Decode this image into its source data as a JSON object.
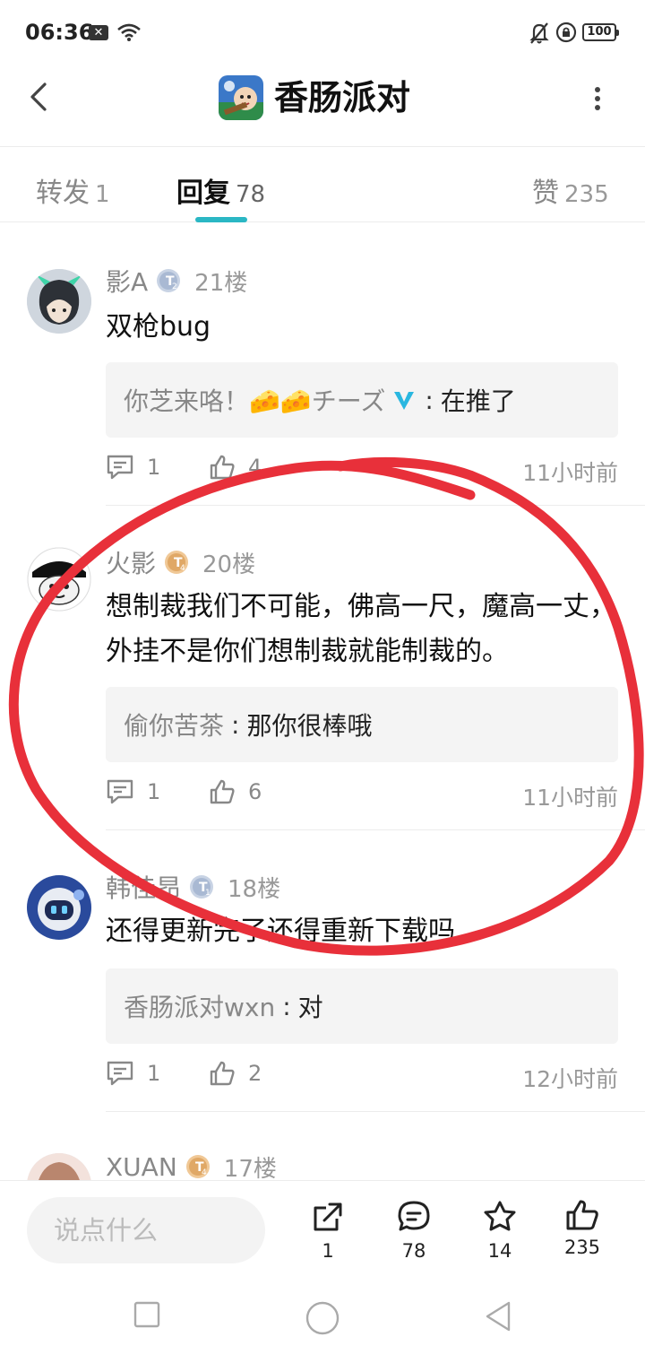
{
  "status_bar": {
    "time": "06:36",
    "battery": "100"
  },
  "header": {
    "title": "香肠派对"
  },
  "tabs": [
    {
      "label": "转发",
      "count": "1"
    },
    {
      "label": "回复",
      "count": "78"
    },
    {
      "label": "赞",
      "count": "235"
    }
  ],
  "colors": {
    "accent": "#2ab7c4",
    "annotation": "#e8303a"
  },
  "comments": [
    {
      "user": "影A",
      "floor": "21楼",
      "text": "双枪bug",
      "reply_user": "你芝来咯！🧀🧀チーズ",
      "reply_text": "在推了",
      "comment_count": "1",
      "like_count": "4",
      "time": "11小时前"
    },
    {
      "user": "火影",
      "floor": "20楼",
      "text": "想制裁我们不可能，佛高一尺，魔高一丈，外挂不是你们想制裁就能制裁的。",
      "reply_user": "偷你苦茶",
      "reply_text": "那你很棒哦",
      "comment_count": "1",
      "like_count": "6",
      "time": "11小时前"
    },
    {
      "user": "韩佳昂",
      "floor": "18楼",
      "text": "还得更新完了还得重新下载吗",
      "reply_user": "香肠派对wxn",
      "reply_text": "对",
      "comment_count": "1",
      "like_count": "2",
      "time": "12小时前"
    },
    {
      "user": "XUAN",
      "floor": "17楼"
    }
  ],
  "bottom_bar": {
    "input_placeholder": "说点什么",
    "share_count": "1",
    "comment_count": "78",
    "favorite_count": "14",
    "like_count": "235"
  }
}
